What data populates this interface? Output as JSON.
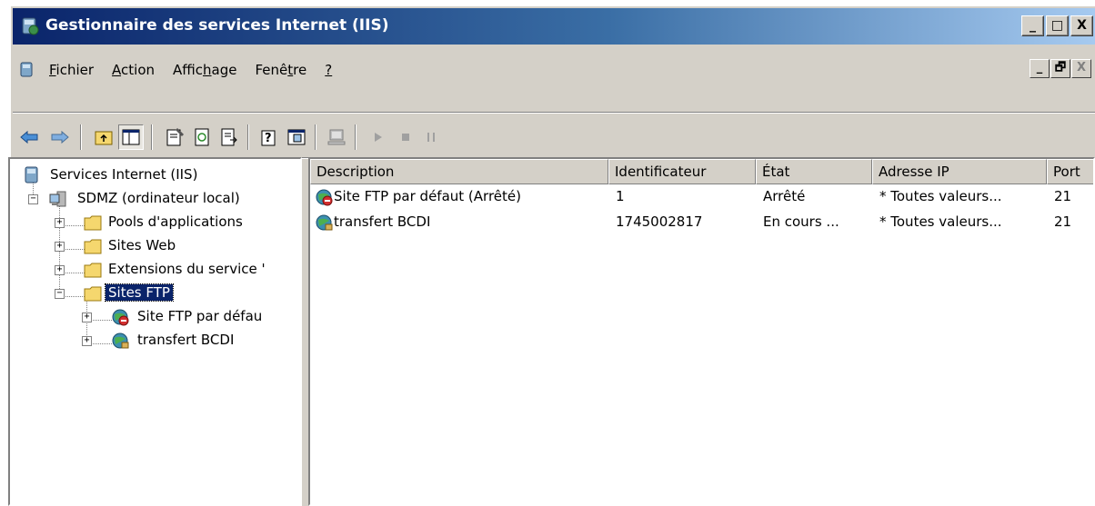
{
  "window": {
    "title": "Gestionnaire des services Internet (IIS)",
    "caption_buttons": [
      "_",
      "□",
      "X"
    ]
  },
  "menu": {
    "items": [
      {
        "pre": "",
        "ul": "F",
        "post": "ichier"
      },
      {
        "pre": "",
        "ul": "A",
        "post": "ction"
      },
      {
        "pre": "Affic",
        "ul": "h",
        "post": "age"
      },
      {
        "pre": "Fenê",
        "ul": "t",
        "post": "re"
      },
      {
        "pre": "",
        "ul": "?",
        "post": ""
      }
    ],
    "mdi_buttons": [
      "_",
      "🗗",
      "X"
    ]
  },
  "toolbar": {
    "icons": [
      "back-icon",
      "forward-icon",
      "up-folder-icon",
      "show-tree-icon",
      "properties-icon",
      "refresh-icon",
      "export-list-icon",
      "help-icon",
      "console-icon",
      "computer-icon",
      "play-icon",
      "stop-icon",
      "pause-icon"
    ]
  },
  "tree": {
    "root": "Services Internet (IIS)",
    "computer": "SDMZ (ordinateur local)",
    "pools": "Pools d'applications",
    "websites": "Sites Web",
    "extensions": "Extensions du service '",
    "ftp_sites": "Sites FTP",
    "ftp_default": "Site FTP par défau",
    "ftp_bcdi": "transfert BCDI"
  },
  "list": {
    "columns": [
      "Description",
      "Identificateur",
      "État",
      "Adresse IP",
      "Port"
    ],
    "rows": [
      {
        "description": "Site FTP par défaut (Arrêté)",
        "id": "1",
        "state": "Arrêté",
        "ip": "* Toutes valeurs...",
        "port": "21",
        "status": "stopped"
      },
      {
        "description": "transfert BCDI",
        "id": "1745002817",
        "state": "En cours ...",
        "ip": "* Toutes valeurs...",
        "port": "21",
        "status": "running"
      }
    ]
  },
  "colors": {
    "title_bar_start": "#0a246a",
    "title_bar_end": "#a6caf0",
    "selection": "#0a246a",
    "chrome": "#d4d0c8",
    "folder": "#f5d76e"
  }
}
